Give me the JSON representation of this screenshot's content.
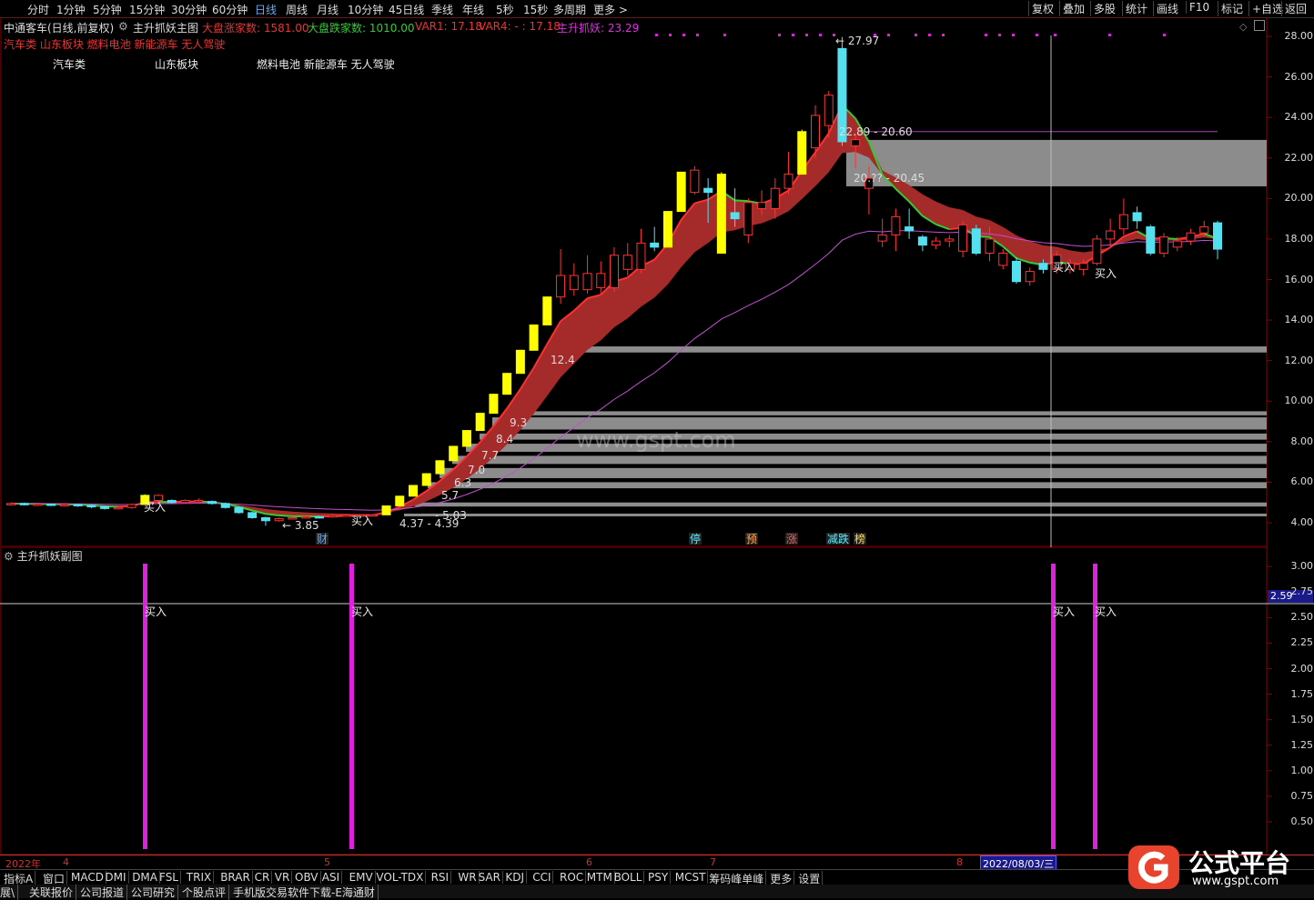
{
  "toolbar": {
    "periods": [
      "分时",
      "1分钟",
      "5分钟",
      "15分钟",
      "30分钟",
      "60分钟",
      "日线",
      "周线",
      "月线",
      "10分钟",
      "45日线",
      "季线",
      "年线",
      "5秒",
      "15秒",
      "多周期",
      "更多 >"
    ],
    "active_index": 6,
    "right_buttons": [
      "复权",
      "叠加",
      "多股",
      "统计",
      "画线",
      "F10",
      "标记",
      "+自选",
      "返回"
    ]
  },
  "info": {
    "stock": "中通客车(日线,前复权)",
    "indicator": "主升抓妖主图",
    "up_label": "大盘涨家数: 1581.00",
    "down_label": "大盘跌家数: 1010.00",
    "var1": "VAR1: 17.18",
    "var4": "VAR4: - : 17.18",
    "zs": "主升抓妖: 23.29"
  },
  "boards_line": "汽车类 山东板块 燃料电池 新能源车 无人驾驶",
  "chart_labels": {
    "board1": "汽车类",
    "board2": "山东板块",
    "board3": "燃料电池 新能源车 无人驾驶",
    "watermark": "www.gspt.com",
    "high": "27.97",
    "low": "3.85",
    "range1": "22.89 - 20.60",
    "range2": "20.?? - 20.45",
    "range3": "4.37 - 4.39",
    "range4": "- 5.03",
    "lvl_12": "12.4",
    "lvl_9": "9.3",
    "lvl_8": "8.4",
    "lvl_7a": "7.7",
    "lvl_7b": "7.0",
    "lvl_6": "6.3",
    "lvl_5": "5.7",
    "buy": "买入",
    "bottom_marks": [
      "财",
      "停",
      "预",
      "涨",
      "减跌",
      "榜"
    ]
  },
  "sub_title": "主升抓妖副图",
  "sub_current": "2.59",
  "main_axis": [
    "28.00",
    "26.00",
    "24.00",
    "22.00",
    "20.00",
    "18.00",
    "16.00",
    "14.00",
    "12.00",
    "10.00",
    "8.00",
    "6.00",
    "4.00"
  ],
  "sub_axis": [
    "3.00",
    "2.75",
    "2.50",
    "2.25",
    "2.00",
    "1.75",
    "1.50",
    "1.25",
    "1.00",
    "0.75",
    "0.50"
  ],
  "date_bar": {
    "labels": [
      "2022年",
      "4",
      "5",
      "6",
      "7",
      "8"
    ],
    "highlight": "2022/08/03/三"
  },
  "tabs": [
    "指标A",
    "窗口",
    "MACD",
    "DMI",
    "DMA",
    "FSL",
    "TRIX",
    "BRAR",
    "CR",
    "VR",
    "OBV",
    "ASI",
    "EMV",
    "VOL-TDX",
    "RSI",
    "WR",
    "SAR",
    "KDJ",
    "CCI",
    "ROC",
    "MTM",
    "BOLL",
    "PSY",
    "MCST",
    "筹码峰单峰",
    "更多",
    "设置"
  ],
  "bottom_links": [
    "展\\",
    "关联报价",
    "公司报道",
    "公司研究",
    "个股点评",
    "手机版交易软件下载-E海通财"
  ],
  "logo": {
    "name": "公式平台",
    "url": "www.gspt.com"
  },
  "colors": {
    "bg": "#000000",
    "grid": "#8b0000",
    "ribbon": "#a52a2a",
    "bull": "#ff3333",
    "bear": "#55e0f0",
    "limit": "#ffff00",
    "signal": "#e020e0",
    "ma_green": "#33cc33"
  },
  "chart_data": {
    "type": "candlestick",
    "price_axis": {
      "min": 4.0,
      "max": 28.0,
      "ticks": [
        28.0,
        26.0,
        24.0,
        22.0,
        20.0,
        18.0,
        16.0,
        14.0,
        12.0,
        10.0,
        8.0,
        6.0,
        4.0
      ]
    },
    "candles": [
      {
        "o": 4.9,
        "c": 4.95,
        "h": 5.0,
        "l": 4.85,
        "t": "u"
      },
      {
        "o": 4.95,
        "c": 4.9,
        "h": 5.0,
        "l": 4.85,
        "t": "d"
      },
      {
        "o": 4.9,
        "c": 4.92,
        "h": 4.98,
        "l": 4.85,
        "t": "u"
      },
      {
        "o": 4.92,
        "c": 4.88,
        "h": 4.95,
        "l": 4.82,
        "t": "d"
      },
      {
        "o": 4.88,
        "c": 4.9,
        "h": 4.95,
        "l": 4.8,
        "t": "u"
      },
      {
        "o": 4.9,
        "c": 4.85,
        "h": 4.92,
        "l": 4.78,
        "t": "d"
      },
      {
        "o": 4.85,
        "c": 4.8,
        "h": 4.9,
        "l": 4.72,
        "t": "d"
      },
      {
        "o": 4.8,
        "c": 4.7,
        "h": 4.85,
        "l": 4.65,
        "t": "d"
      },
      {
        "o": 4.7,
        "c": 4.75,
        "h": 4.8,
        "l": 4.65,
        "t": "u"
      },
      {
        "o": 4.75,
        "c": 4.9,
        "h": 4.95,
        "l": 4.7,
        "t": "u"
      },
      {
        "o": 4.9,
        "c": 5.35,
        "h": 5.4,
        "l": 4.9,
        "t": "y"
      },
      {
        "o": 5.35,
        "c": 5.1,
        "h": 5.4,
        "l": 5.0,
        "t": "u"
      },
      {
        "o": 5.1,
        "c": 5.0,
        "h": 5.15,
        "l": 4.95,
        "t": "d"
      },
      {
        "o": 5.0,
        "c": 5.1,
        "h": 5.15,
        "l": 4.95,
        "t": "u"
      },
      {
        "o": 5.1,
        "c": 5.05,
        "h": 5.2,
        "l": 5.0,
        "t": "u"
      },
      {
        "o": 5.05,
        "c": 4.95,
        "h": 5.1,
        "l": 4.9,
        "t": "d"
      },
      {
        "o": 4.95,
        "c": 4.75,
        "h": 5.0,
        "l": 4.7,
        "t": "d"
      },
      {
        "o": 4.75,
        "c": 4.5,
        "h": 4.8,
        "l": 4.45,
        "t": "d"
      },
      {
        "o": 4.5,
        "c": 4.25,
        "h": 4.55,
        "l": 4.2,
        "t": "d"
      },
      {
        "o": 4.25,
        "c": 4.1,
        "h": 4.3,
        "l": 3.85,
        "t": "d"
      },
      {
        "o": 4.1,
        "c": 4.2,
        "h": 4.25,
        "l": 4.05,
        "t": "u"
      },
      {
        "o": 4.2,
        "c": 4.25,
        "h": 4.3,
        "l": 4.15,
        "t": "u"
      },
      {
        "o": 4.25,
        "c": 4.3,
        "h": 4.35,
        "l": 4.2,
        "t": "u"
      },
      {
        "o": 4.3,
        "c": 4.28,
        "h": 4.35,
        "l": 4.22,
        "t": "d"
      },
      {
        "o": 4.28,
        "c": 4.35,
        "h": 4.4,
        "l": 4.25,
        "t": "u"
      },
      {
        "o": 4.35,
        "c": 4.38,
        "h": 4.42,
        "l": 4.3,
        "t": "u"
      },
      {
        "o": 4.38,
        "c": 4.37,
        "h": 4.42,
        "l": 4.32,
        "t": "u"
      },
      {
        "o": 4.37,
        "c": 4.39,
        "h": 4.42,
        "l": 4.33,
        "t": "u"
      },
      {
        "o": 4.39,
        "c": 4.83,
        "h": 4.85,
        "l": 4.39,
        "t": "y"
      },
      {
        "o": 4.83,
        "c": 5.31,
        "h": 5.33,
        "l": 4.83,
        "t": "y"
      },
      {
        "o": 5.31,
        "c": 5.84,
        "h": 5.86,
        "l": 5.31,
        "t": "y"
      },
      {
        "o": 5.84,
        "c": 6.42,
        "h": 6.44,
        "l": 5.84,
        "t": "y"
      },
      {
        "o": 6.42,
        "c": 7.06,
        "h": 7.08,
        "l": 6.42,
        "t": "y"
      },
      {
        "o": 7.06,
        "c": 7.77,
        "h": 7.79,
        "l": 7.06,
        "t": "y"
      },
      {
        "o": 7.77,
        "c": 8.55,
        "h": 8.57,
        "l": 7.77,
        "t": "y"
      },
      {
        "o": 8.55,
        "c": 9.4,
        "h": 9.42,
        "l": 8.55,
        "t": "y"
      },
      {
        "o": 9.4,
        "c": 10.34,
        "h": 10.36,
        "l": 9.4,
        "t": "y"
      },
      {
        "o": 10.34,
        "c": 11.37,
        "h": 11.39,
        "l": 10.34,
        "t": "y"
      },
      {
        "o": 11.37,
        "c": 12.51,
        "h": 12.53,
        "l": 11.37,
        "t": "y"
      },
      {
        "o": 12.51,
        "c": 13.76,
        "h": 13.78,
        "l": 12.51,
        "t": "y"
      },
      {
        "o": 13.76,
        "c": 15.14,
        "h": 15.16,
        "l": 13.76,
        "t": "y"
      },
      {
        "o": 15.14,
        "c": 16.2,
        "h": 17.5,
        "l": 14.8,
        "t": "u"
      },
      {
        "o": 16.2,
        "c": 15.5,
        "h": 16.8,
        "l": 15.2,
        "t": "u"
      },
      {
        "o": 15.5,
        "c": 16.3,
        "h": 17.2,
        "l": 15.3,
        "t": "u"
      },
      {
        "o": 16.3,
        "c": 15.6,
        "h": 16.9,
        "l": 15.3,
        "t": "u"
      },
      {
        "o": 15.6,
        "c": 17.2,
        "h": 17.6,
        "l": 15.4,
        "t": "u"
      },
      {
        "o": 17.2,
        "c": 16.5,
        "h": 17.8,
        "l": 16.2,
        "t": "u"
      },
      {
        "o": 16.5,
        "c": 17.8,
        "h": 18.5,
        "l": 16.3,
        "t": "u"
      },
      {
        "o": 17.8,
        "c": 17.6,
        "h": 18.6,
        "l": 17.4,
        "t": "b"
      },
      {
        "o": 17.6,
        "c": 19.36,
        "h": 19.38,
        "l": 17.6,
        "t": "y"
      },
      {
        "o": 19.36,
        "c": 21.3,
        "h": 21.32,
        "l": 19.36,
        "t": "y"
      },
      {
        "o": 20.3,
        "c": 21.4,
        "h": 21.6,
        "l": 20.2,
        "t": "u"
      },
      {
        "o": 20.5,
        "c": 20.3,
        "h": 21.0,
        "l": 18.8,
        "t": "b"
      },
      {
        "o": 17.3,
        "c": 21.2,
        "h": 21.3,
        "l": 17.3,
        "t": "y"
      },
      {
        "o": 19.3,
        "c": 19.0,
        "h": 20.5,
        "l": 18.6,
        "t": "b"
      },
      {
        "o": 18.2,
        "c": 19.8,
        "h": 20.0,
        "l": 17.8,
        "t": "u"
      },
      {
        "o": 19.8,
        "c": 19.5,
        "h": 20.4,
        "l": 19.2,
        "t": "u"
      },
      {
        "o": 19.5,
        "c": 20.5,
        "h": 21.0,
        "l": 19.0,
        "t": "u"
      },
      {
        "o": 20.5,
        "c": 21.2,
        "h": 22.3,
        "l": 20.2,
        "t": "u"
      },
      {
        "o": 21.2,
        "c": 23.3,
        "h": 23.4,
        "l": 21.2,
        "t": "y"
      },
      {
        "o": 22.5,
        "c": 24.1,
        "h": 24.6,
        "l": 22.0,
        "t": "u"
      },
      {
        "o": 23.6,
        "c": 25.1,
        "h": 25.3,
        "l": 23.0,
        "t": "u"
      },
      {
        "o": 22.8,
        "c": 27.4,
        "h": 27.97,
        "l": 22.6,
        "t": "b"
      },
      {
        "o": 22.9,
        "c": 22.6,
        "h": 23.2,
        "l": 21.5,
        "t": "u"
      },
      {
        "o": 21.0,
        "c": 20.5,
        "h": 21.6,
        "l": 19.2,
        "t": "u"
      },
      {
        "o": 18.2,
        "c": 17.9,
        "h": 19.0,
        "l": 17.6,
        "t": "u"
      },
      {
        "o": 18.2,
        "c": 19.1,
        "h": 19.5,
        "l": 17.4,
        "t": "u"
      },
      {
        "o": 18.4,
        "c": 18.6,
        "h": 19.5,
        "l": 18.0,
        "t": "b"
      },
      {
        "o": 18.1,
        "c": 17.7,
        "h": 18.2,
        "l": 17.4,
        "t": "b"
      },
      {
        "o": 17.7,
        "c": 17.9,
        "h": 18.1,
        "l": 17.5,
        "t": "u"
      },
      {
        "o": 17.9,
        "c": 18.0,
        "h": 18.2,
        "l": 17.6,
        "t": "u"
      },
      {
        "o": 17.4,
        "c": 18.7,
        "h": 18.9,
        "l": 17.1,
        "t": "u"
      },
      {
        "o": 18.5,
        "c": 17.3,
        "h": 18.7,
        "l": 17.2,
        "t": "b"
      },
      {
        "o": 17.3,
        "c": 18.0,
        "h": 18.6,
        "l": 16.9,
        "t": "u"
      },
      {
        "o": 17.3,
        "c": 16.7,
        "h": 17.5,
        "l": 16.5,
        "t": "u"
      },
      {
        "o": 16.9,
        "c": 15.9,
        "h": 17.1,
        "l": 15.8,
        "t": "b"
      },
      {
        "o": 15.9,
        "c": 16.4,
        "h": 16.6,
        "l": 15.7,
        "t": "u"
      },
      {
        "o": 16.8,
        "c": 16.5,
        "h": 17.0,
        "l": 16.3,
        "t": "b"
      },
      {
        "o": 16.5,
        "c": 17.2,
        "h": 17.4,
        "l": 16.3,
        "t": "u"
      },
      {
        "o": 16.8,
        "c": 16.5,
        "h": 17.0,
        "l": 16.3,
        "t": "u"
      },
      {
        "o": 16.5,
        "c": 16.8,
        "h": 17.0,
        "l": 16.2,
        "t": "u"
      },
      {
        "o": 16.8,
        "c": 18.0,
        "h": 18.2,
        "l": 16.7,
        "t": "u"
      },
      {
        "o": 18.0,
        "c": 18.4,
        "h": 19.0,
        "l": 17.6,
        "t": "u"
      },
      {
        "o": 18.5,
        "c": 19.2,
        "h": 20.0,
        "l": 18.2,
        "t": "u"
      },
      {
        "o": 19.3,
        "c": 18.9,
        "h": 19.6,
        "l": 18.5,
        "t": "b"
      },
      {
        "o": 18.6,
        "c": 17.3,
        "h": 18.7,
        "l": 17.2,
        "t": "b"
      },
      {
        "o": 17.3,
        "c": 18.1,
        "h": 18.3,
        "l": 17.1,
        "t": "u"
      },
      {
        "o": 17.6,
        "c": 17.9,
        "h": 18.1,
        "l": 17.4,
        "t": "u"
      },
      {
        "o": 17.9,
        "c": 18.3,
        "h": 18.5,
        "l": 17.7,
        "t": "u"
      },
      {
        "o": 18.3,
        "c": 18.6,
        "h": 18.9,
        "l": 18.1,
        "t": "u"
      },
      {
        "o": 18.8,
        "c": 17.5,
        "h": 18.9,
        "l": 17.0,
        "t": "b"
      }
    ],
    "support_levels": [
      22.89,
      20.6,
      20.45,
      12.4,
      9.3,
      8.4,
      7.7,
      7.0,
      6.3,
      5.7,
      5.03,
      4.39
    ],
    "sub_axis": {
      "min": 0.25,
      "max": 3.1
    },
    "signals": [
      5,
      13,
      50,
      52
    ]
  }
}
